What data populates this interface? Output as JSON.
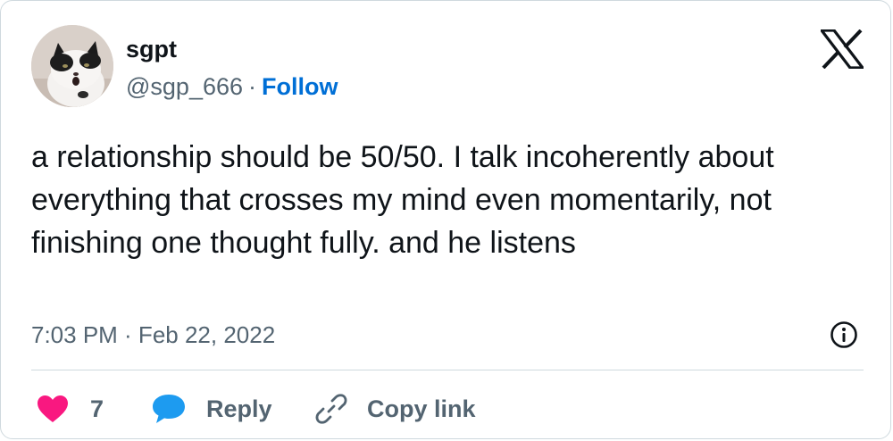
{
  "author": {
    "display_name": "sgpt",
    "handle": "@sgp_666",
    "separator": "·",
    "follow_label": "Follow"
  },
  "tweet": {
    "text": "a relationship should be 50/50. I talk incoherently about everything that crosses my mind even momentarily, not finishing one thought fully. and he listens",
    "timestamp": "7:03 PM · Feb 22, 2022"
  },
  "actions": {
    "like_count": "7",
    "reply_label": "Reply",
    "copy_link_label": "Copy link"
  },
  "icons": {
    "brand": "x-logo-icon",
    "info": "info-icon",
    "like": "heart-icon",
    "reply": "speech-bubble-icon",
    "copy": "link-icon"
  },
  "colors": {
    "text_primary": "#0f1419",
    "text_secondary": "#536471",
    "follow_blue": "#006fd6",
    "like_red": "#f91880",
    "reply_blue": "#1d9bf0",
    "border": "#cfd9de"
  }
}
